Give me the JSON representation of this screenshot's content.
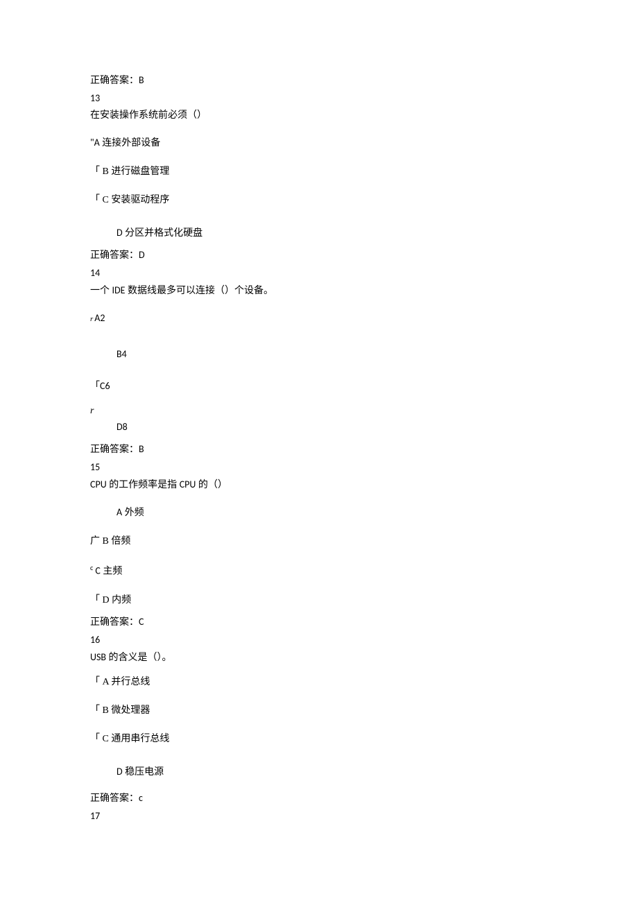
{
  "q12": {
    "answer_label": "正确答案：",
    "answer_value": "B"
  },
  "q13": {
    "number": "13",
    "text": "在安装操作系统前必须（）",
    "prefix_a": "\"A",
    "option_a": " 连接外部设备",
    "prefix_b": "「 B",
    "option_b": " 进行磁盘管理",
    "prefix_c": "「 C",
    "option_c": " 安装驱动程序",
    "prefix_d": "D",
    "option_d": " 分区并格式化硬盘",
    "answer_label": "正确答案：",
    "answer_value": "D"
  },
  "q14": {
    "number": "14",
    "text_part1": "一个 ",
    "text_ide": "IDE",
    "text_part2": " 数据线最多可以连接（）个设备。",
    "prefix_a": "r",
    "option_a_label": "A2",
    "option_b_label": "B4",
    "prefix_c": "「",
    "option_c_label": "C6",
    "r_marker": "r",
    "option_d_label": "D8",
    "answer_label": "正确答案：",
    "answer_value": "B"
  },
  "q15": {
    "number": "15",
    "text_cpu": "CPU",
    "text_part1": " 的工作频率是指 ",
    "text_part2": " 的（）",
    "prefix_a": "A",
    "option_a": " 外频",
    "prefix_b": "广 B",
    "option_b": " 倍频",
    "prefix_c_sup": "c",
    "prefix_c": " C",
    "option_c": " 主频",
    "prefix_d": "「 D",
    "option_d": " 内频",
    "answer_label": "正确答案：",
    "answer_value": "C"
  },
  "q16": {
    "number": "16",
    "text_usb": "USB",
    "text_part1": " 的含义是（）。",
    "prefix_a": "「 A",
    "option_a": " 并行总线",
    "prefix_b": "「 B",
    "option_b": " 微处理器",
    "prefix_c": "「 C",
    "option_c": " 通用串行总线",
    "prefix_d": "D",
    "option_d": " 稳压电源",
    "answer_label": "正确答案：",
    "answer_value": "c"
  },
  "q17": {
    "number": "17"
  }
}
